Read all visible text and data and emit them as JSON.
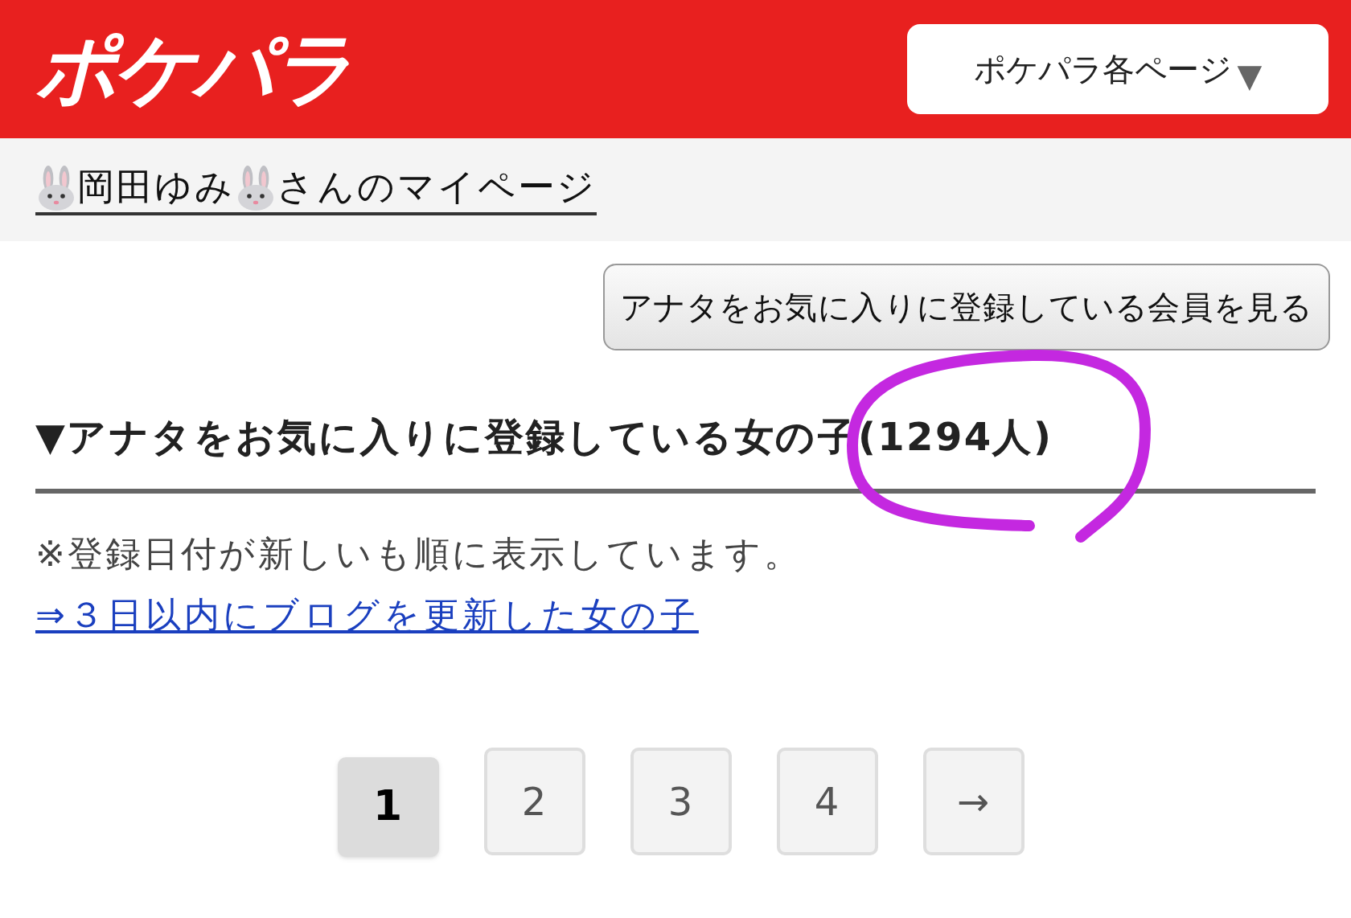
{
  "header": {
    "logo": "ポケパラ",
    "menu": {
      "label": "ポケパラ各ページ",
      "caret": "▼"
    }
  },
  "profile_title": {
    "name": "岡田ゆみ",
    "suffix": "さんのマイページ"
  },
  "favorites_button": "アナタをお気に入りに登録している会員を見る",
  "section": {
    "marker": "▼",
    "title": "アナタをお気に入りに登録している女の子",
    "count": "(1294人)"
  },
  "note": "※登録日付が新しいも順に表示しています。",
  "blog_link": "⇒３日以内にブログを更新した女の子",
  "pagination": [
    {
      "label": "1",
      "selected": true
    },
    {
      "label": "2",
      "selected": false
    },
    {
      "label": "3",
      "selected": false
    },
    {
      "label": "4",
      "selected": false
    },
    {
      "label": "→",
      "selected": false
    }
  ]
}
